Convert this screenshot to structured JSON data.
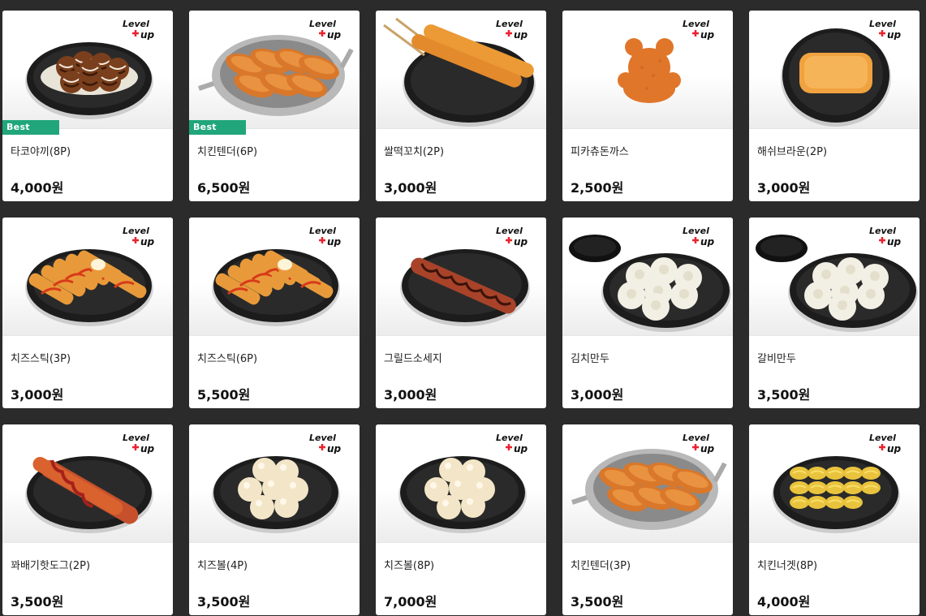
{
  "products": [
    {
      "name": "타코야끼(8P)",
      "price": "4,000원",
      "badge": "Best",
      "image_icon": "takoyaki-plate-icon",
      "dish": "takoyaki"
    },
    {
      "name": "치킨텐더(6P)",
      "price": "6,500원",
      "badge": "Best",
      "image_icon": "chicken-tender-pan-icon",
      "dish": "tender-pan"
    },
    {
      "name": "쌀떡꼬치(2P)",
      "price": "3,000원",
      "badge": "",
      "image_icon": "rice-cake-skewer-icon",
      "dish": "skewer"
    },
    {
      "name": "피카츄돈까스",
      "price": "2,500원",
      "badge": "",
      "image_icon": "pikachu-cutlet-icon",
      "dish": "cutlet"
    },
    {
      "name": "해쉬브라운(2P)",
      "price": "3,000원",
      "badge": "",
      "image_icon": "hash-brown-icon",
      "dish": "hashbrown"
    },
    {
      "name": "치즈스틱(3P)",
      "price": "3,000원",
      "badge": "",
      "image_icon": "cheese-stick-icon",
      "dish": "cheesestick"
    },
    {
      "name": "치즈스틱(6P)",
      "price": "5,500원",
      "badge": "",
      "image_icon": "cheese-stick-icon",
      "dish": "cheesestick"
    },
    {
      "name": "그릴드소세지",
      "price": "3,000원",
      "badge": "",
      "image_icon": "grilled-sausage-icon",
      "dish": "sausage"
    },
    {
      "name": "김치만두",
      "price": "3,000원",
      "badge": "",
      "image_icon": "kimchi-dumpling-icon",
      "dish": "dumpling"
    },
    {
      "name": "갈비만두",
      "price": "3,500원",
      "badge": "",
      "image_icon": "galbi-dumpling-icon",
      "dish": "dumpling"
    },
    {
      "name": "꽈배기핫도그(2P)",
      "price": "3,500원",
      "badge": "",
      "image_icon": "twisted-hotdog-icon",
      "dish": "hotdog"
    },
    {
      "name": "치즈볼(4P)",
      "price": "3,500원",
      "badge": "",
      "image_icon": "cheese-ball-icon",
      "dish": "cheeseball"
    },
    {
      "name": "치즈볼(8P)",
      "price": "7,000원",
      "badge": "",
      "image_icon": "cheese-ball-icon",
      "dish": "cheeseball"
    },
    {
      "name": "치킨텐더(3P)",
      "price": "3,500원",
      "badge": "",
      "image_icon": "chicken-tender-pan-icon",
      "dish": "tender-pan"
    },
    {
      "name": "치킨너겟(8P)",
      "price": "4,000원",
      "badge": "",
      "image_icon": "chicken-nugget-icon",
      "dish": "nugget"
    }
  ],
  "brand_logo": {
    "text": "Level up",
    "icon": "level-up-logo-icon",
    "colors": {
      "black": "#111111",
      "red": "#e8232e"
    }
  },
  "colors": {
    "page_bg": "#2b2b2b",
    "best_badge": "#20a67a",
    "card_bg": "#ffffff"
  }
}
